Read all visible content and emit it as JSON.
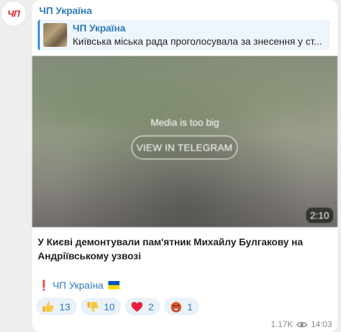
{
  "avatar": {
    "initials": "ЧП"
  },
  "channel": {
    "name": "ЧП Україна"
  },
  "reply": {
    "title": "ЧП Україна",
    "text": "Київська міська рада проголосувала за знесення у ст..."
  },
  "media": {
    "message": "Media is too big",
    "button_label": "VIEW IN TELEGRAM",
    "duration": "2:10"
  },
  "post": {
    "text": "У Києві демонтували пам'ятник Михайлу Булгакову на Андріївському узвозі"
  },
  "signature": {
    "mark": "❗",
    "link_text": "ЧП Україна"
  },
  "reactions": [
    {
      "icon": "thumbs-up-icon",
      "count": "13"
    },
    {
      "icon": "thumbs-down-icon",
      "count": "10"
    },
    {
      "icon": "heart-icon",
      "count": "2"
    },
    {
      "icon": "angry-face-icon",
      "count": "1"
    }
  ],
  "meta": {
    "views": "1.17K",
    "time": "14:03"
  },
  "colors": {
    "accent": "#2f7ab8",
    "avatar_text": "#e0242d",
    "reaction_bg": "#e9f1f9",
    "flag_blue": "#0057b7",
    "flag_yellow": "#ffd700"
  }
}
